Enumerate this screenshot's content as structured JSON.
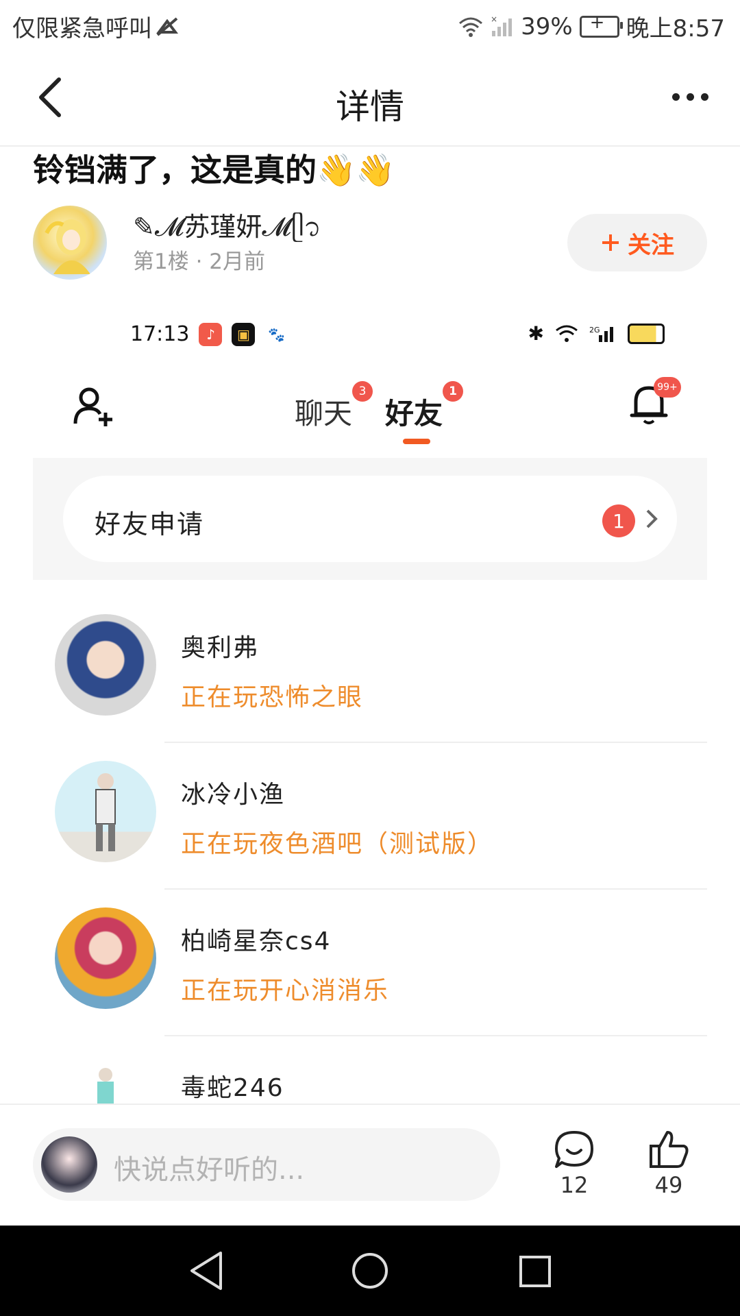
{
  "status_bar": {
    "carrier": "仅限紧急呼叫",
    "battery": "39%",
    "time": "晚上8:57"
  },
  "header": {
    "title": "详情"
  },
  "post": {
    "title": "铃铛满了，这是真的👋👋",
    "author_name": "✎𝓜苏瑾妍𝓜ᥫ᭡",
    "meta": "第1楼 · 2月前",
    "follow_label": "关注"
  },
  "embedded_screenshot": {
    "status_time": "17:13",
    "tabs": [
      {
        "label": "聊天",
        "badge": "3"
      },
      {
        "label": "好友",
        "badge": "1"
      }
    ],
    "bell_badge": "99+",
    "friend_request": {
      "label": "好友申请",
      "badge": "1"
    },
    "friends": [
      {
        "name": "奥利弗",
        "status": "正在玩恐怖之眼"
      },
      {
        "name": "冰冷小渔",
        "status": "正在玩夜色酒吧（测试版）"
      },
      {
        "name": "柏崎星奈cs4",
        "status": "正在玩开心消消乐"
      },
      {
        "name": "毒蛇246",
        "status": ""
      }
    ]
  },
  "bottom_bar": {
    "comment_placeholder": "快说点好听的...",
    "comment_count": "12",
    "like_count": "49"
  },
  "colors": {
    "accent": "#ff5a1f",
    "status_orange": "#ee8c2c",
    "badge_red": "#f0564c"
  }
}
